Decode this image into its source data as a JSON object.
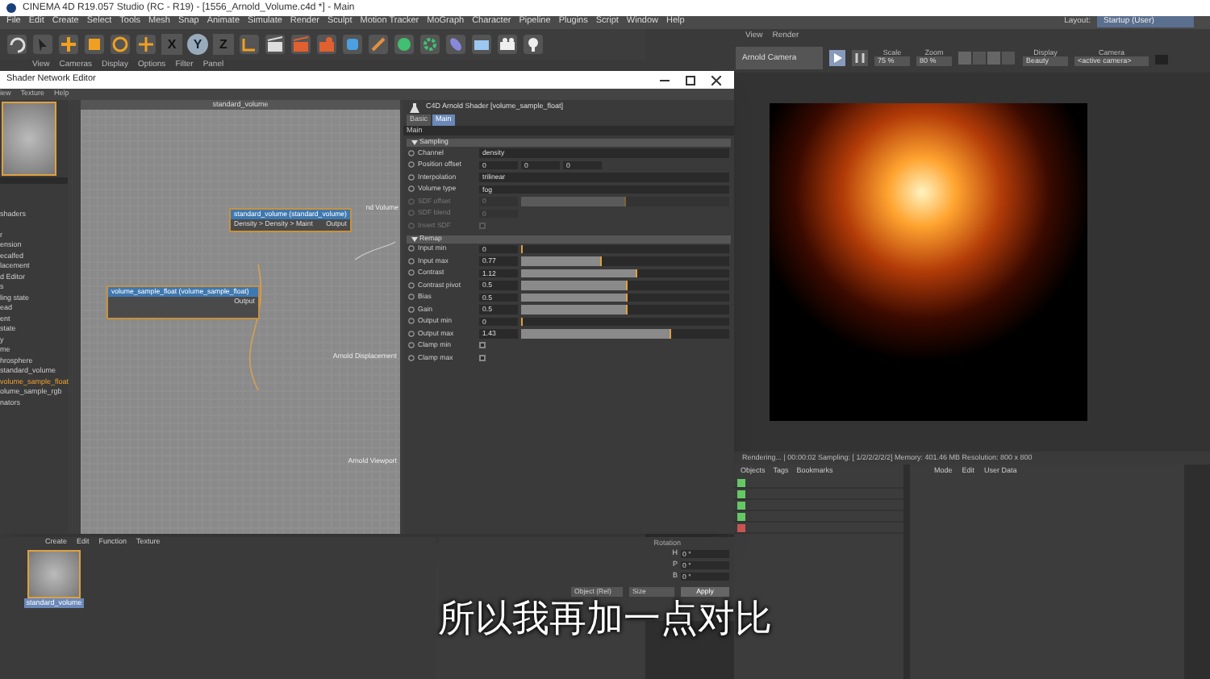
{
  "window": {
    "title": "CINEMA 4D R19.057 Studio (RC - R19) - [1556_Arnold_Volume.c4d *] - Main"
  },
  "menu": [
    "File",
    "Edit",
    "Create",
    "Select",
    "Tools",
    "Mesh",
    "Snap",
    "Animate",
    "Simulate",
    "Render",
    "Sculpt",
    "Motion Tracker",
    "MoGraph",
    "Character",
    "Pipeline",
    "Plugins",
    "Script",
    "Window",
    "Help"
  ],
  "layout": {
    "label": "Layout:",
    "value": "Startup (User)"
  },
  "axis_buttons": [
    {
      "label": "X",
      "selected": false
    },
    {
      "label": "Y",
      "selected": true
    },
    {
      "label": "Z",
      "selected": false
    }
  ],
  "viewport_menu": [
    "View",
    "Cameras",
    "Display",
    "Options",
    "Filter",
    "Panel"
  ],
  "shader_editor": {
    "title": "Shader Network Editor",
    "menu": [
      "iew",
      "Texture",
      "Help"
    ],
    "shader_list": [
      {
        "label": "shaders",
        "selected": false
      },
      {
        "label": "r",
        "selected": false
      },
      {
        "label": "ension",
        "selected": false
      },
      {
        "label": "ecalfed",
        "selected": false
      },
      {
        "label": "lacement",
        "selected": false
      },
      {
        "label": "d Editor",
        "selected": false
      },
      {
        "label": "s",
        "selected": false
      },
      {
        "label": "ling state",
        "selected": false
      },
      {
        "label": "ead",
        "selected": false
      },
      {
        "label": "ent",
        "selected": false
      },
      {
        "label": "state",
        "selected": false
      },
      {
        "label": "y",
        "selected": false
      },
      {
        "label": "me",
        "selected": false
      },
      {
        "label": "hrosphere",
        "selected": false
      },
      {
        "label": "standard_volume",
        "selected": false
      },
      {
        "label": "volume_sample_float",
        "selected": true
      },
      {
        "label": "olume_sample_rgb",
        "selected": false
      },
      {
        "label": "nators",
        "selected": false
      }
    ],
    "canvas_title": "standard_volume",
    "nodes": [
      {
        "title": "standard_volume (standard_volume)",
        "input": "Density > Density > Maint",
        "output": "Output"
      },
      {
        "title": "volume_sample_float (volume_sample_float)",
        "output": "Output"
      }
    ],
    "ports": [
      "nd Volume",
      "Arnold Displacement",
      "Arnold Viewport"
    ],
    "attributes": {
      "title": "C4D Arnold Shader [volume_sample_float]",
      "tabs": [
        {
          "label": "Basic",
          "selected": false
        },
        {
          "label": "Main",
          "selected": true
        }
      ],
      "header": "Main",
      "sections": [
        {
          "title": "Sampling",
          "params": [
            {
              "kind": "text",
              "label": "Channel",
              "value": "density",
              "disabled": false
            },
            {
              "kind": "vector",
              "label": "Position offset",
              "values": [
                "0",
                "0",
                "0"
              ],
              "disabled": false
            },
            {
              "kind": "dropdown",
              "label": "Interpolation",
              "value": "trilinear",
              "disabled": false
            },
            {
              "kind": "dropdown",
              "label": "Volume type",
              "value": "fog",
              "disabled": false
            },
            {
              "kind": "slider",
              "label": "SDF offset",
              "value": "0",
              "level": 0.5,
              "disabled": true
            },
            {
              "kind": "number",
              "label": "SDF blend",
              "value": "0",
              "disabled": true
            },
            {
              "kind": "checkbox",
              "label": "Invert SDF",
              "checked": false,
              "disabled": true
            }
          ]
        },
        {
          "title": "Remap",
          "params": [
            {
              "kind": "slider",
              "label": "Input min",
              "value": "0",
              "level": 0,
              "disabled": false
            },
            {
              "kind": "slider",
              "label": "Input max",
              "value": "0.77",
              "level": 0.39,
              "disabled": false
            },
            {
              "kind": "slider",
              "label": "Contrast",
              "value": "1.12",
              "level": 0.56,
              "disabled": false
            },
            {
              "kind": "slider",
              "label": "Contrast pivot",
              "value": "0.5",
              "level": 0.51,
              "disabled": false
            },
            {
              "kind": "slider",
              "label": "Bias",
              "value": "0.5",
              "level": 0.51,
              "disabled": false
            },
            {
              "kind": "slider",
              "label": "Gain",
              "value": "0.5",
              "level": 0.51,
              "disabled": false
            },
            {
              "kind": "slider",
              "label": "Output min",
              "value": "0",
              "level": 0,
              "disabled": false
            },
            {
              "kind": "slider",
              "label": "Output max",
              "value": "1.43",
              "level": 0.72,
              "disabled": false
            },
            {
              "kind": "checkbox",
              "label": "Clamp min",
              "checked": false,
              "disabled": false
            },
            {
              "kind": "checkbox",
              "label": "Clamp max",
              "checked": false,
              "disabled": false
            }
          ]
        }
      ]
    }
  },
  "render_view": {
    "menu": [
      "View",
      "Render"
    ],
    "camera": "Arnold Camera",
    "scale": {
      "label": "Scale",
      "value": "75 %"
    },
    "zoom": {
      "label": "Zoom",
      "value": "80 %"
    },
    "display": {
      "label": "Display",
      "value": "Beauty"
    },
    "camera_select": {
      "label": "Camera",
      "value": "<active camera>"
    },
    "status": "Rendering... | 00:00:02  Sampling: [ 1/2/2/2/2/2]  Memory: 401.46 MB  Resolution: 800 x 800"
  },
  "object_manager": {
    "menu": [
      "Objects",
      "Tags",
      "Bookmarks"
    ],
    "rows": [
      {
        "checked": true
      },
      {
        "checked": true
      },
      {
        "checked": true
      },
      {
        "checked": true
      },
      {
        "checked": false
      }
    ]
  },
  "attribute_manager": {
    "menu": [
      "Mode",
      "Edit",
      "User Data"
    ]
  },
  "material_manager": {
    "menu": [
      "Create",
      "Edit",
      "Function",
      "Texture"
    ],
    "material": "standard_volume"
  },
  "coordinates": {
    "header": "Rotation",
    "rows": [
      {
        "axis": "H",
        "value": "0 °"
      },
      {
        "axis": "P",
        "value": "0 °"
      },
      {
        "axis": "B",
        "value": "0 °"
      }
    ],
    "mode": "Object (Rel)",
    "size_mode": "Size",
    "apply": "Apply"
  },
  "subtitle": "所以我再加一点对比"
}
